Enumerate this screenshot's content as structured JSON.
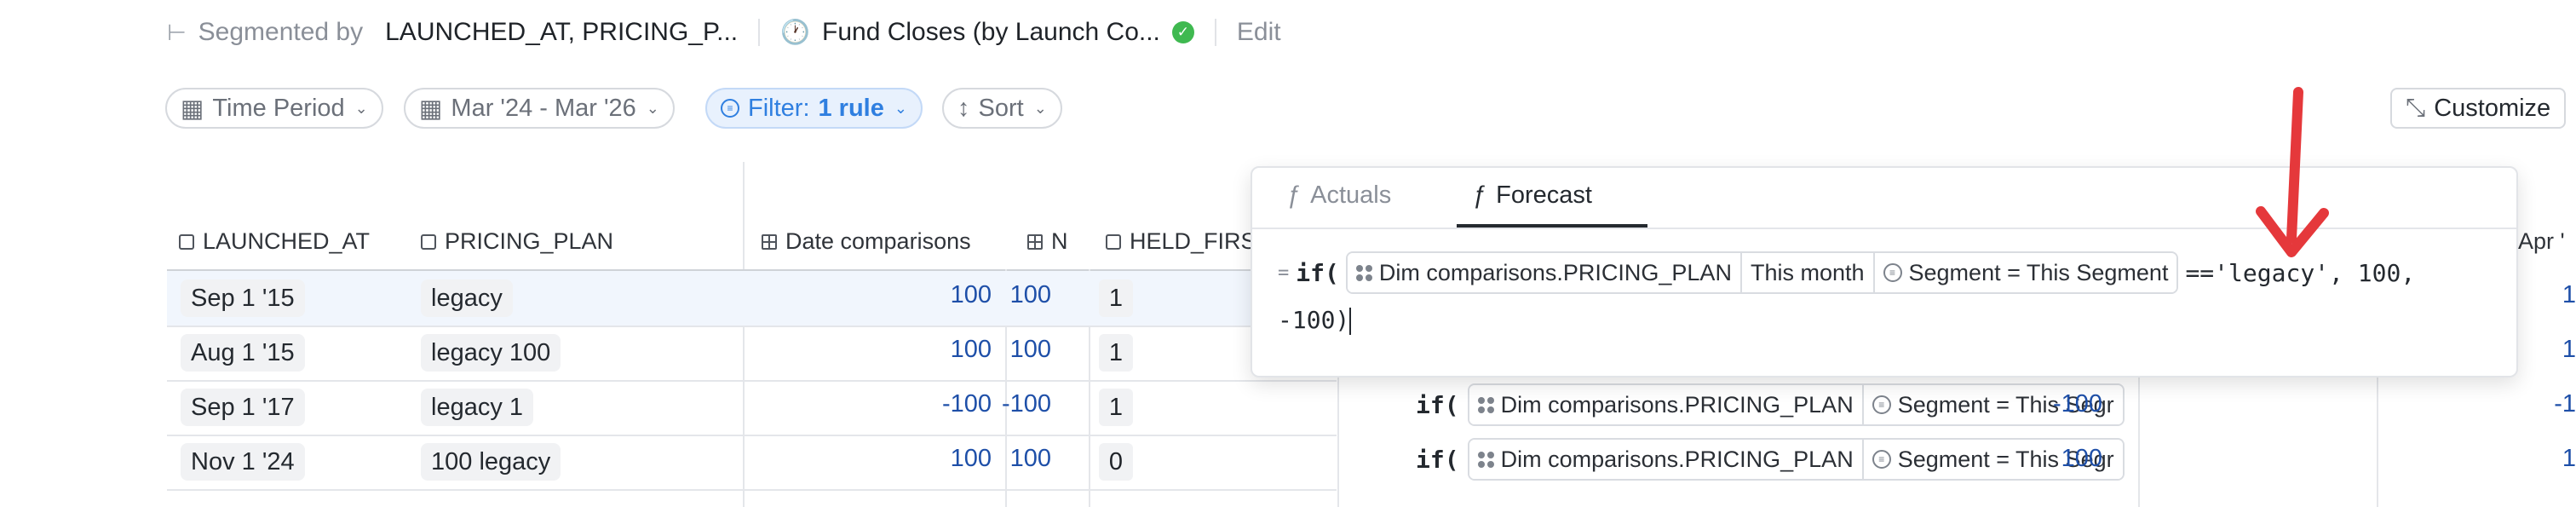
{
  "breadcrumbs": {
    "segmented_label": "Segmented by",
    "segmented_value": "LAUNCHED_AT, PRICING_P...",
    "metric_name": "Fund Closes (by Launch Co...",
    "edit_label": "Edit"
  },
  "toolbar": {
    "time_period": "Time Period",
    "date_range": "Mar '24 - Mar '26",
    "filter_label": "Filter:",
    "filter_value": "1 rule",
    "sort": "Sort",
    "customize": "Customize"
  },
  "columns": {
    "launched_at": "LAUNCHED_AT",
    "pricing_plan": "PRICING_PLAN",
    "date_comparisons": "Date comparisons",
    "n": "N",
    "held_first": "HELD_FIRS",
    "apr": "Apr '"
  },
  "rows": [
    {
      "launched": "Sep 1 '15",
      "plan": "legacy",
      "date_cmp": "100",
      "n": "100",
      "held": "1",
      "right_val": "",
      "far_val": "1"
    },
    {
      "launched": "Aug 1 '15",
      "plan": "legacy 100",
      "date_cmp": "100",
      "n": "100",
      "held": "1",
      "right_val": "",
      "far_val": "1"
    },
    {
      "launched": "Sep 1 '17",
      "plan": "legacy 1",
      "date_cmp": "-100",
      "n": "-100",
      "held": "1",
      "right_val": "-100",
      "far_val": "-1"
    },
    {
      "launched": "Nov 1 '24",
      "plan": "100 legacy",
      "date_cmp": "100",
      "n": "100",
      "held": "0",
      "right_val": "100",
      "far_val": "1"
    }
  ],
  "formula_rows": {
    "if_kw": "if(",
    "dim": "Dim comparisons.PRICING_PLAN",
    "segment": "Segment = This Segr"
  },
  "popup": {
    "tab_actuals": "Actuals",
    "tab_forecast": "Forecast",
    "eq": "=",
    "fn": "if(",
    "dim": "Dim comparisons.PRICING_PLAN",
    "period": "This month",
    "segment": "Segment = This Segment",
    "tail1": "=='legacy', 100,",
    "tail2": "-100)"
  },
  "colors": {
    "accent": "#2f7fe0",
    "number": "#1e4fa8",
    "success": "#3fb950",
    "arrow": "#e5383b",
    "selected_row": "#f1f6fd"
  }
}
